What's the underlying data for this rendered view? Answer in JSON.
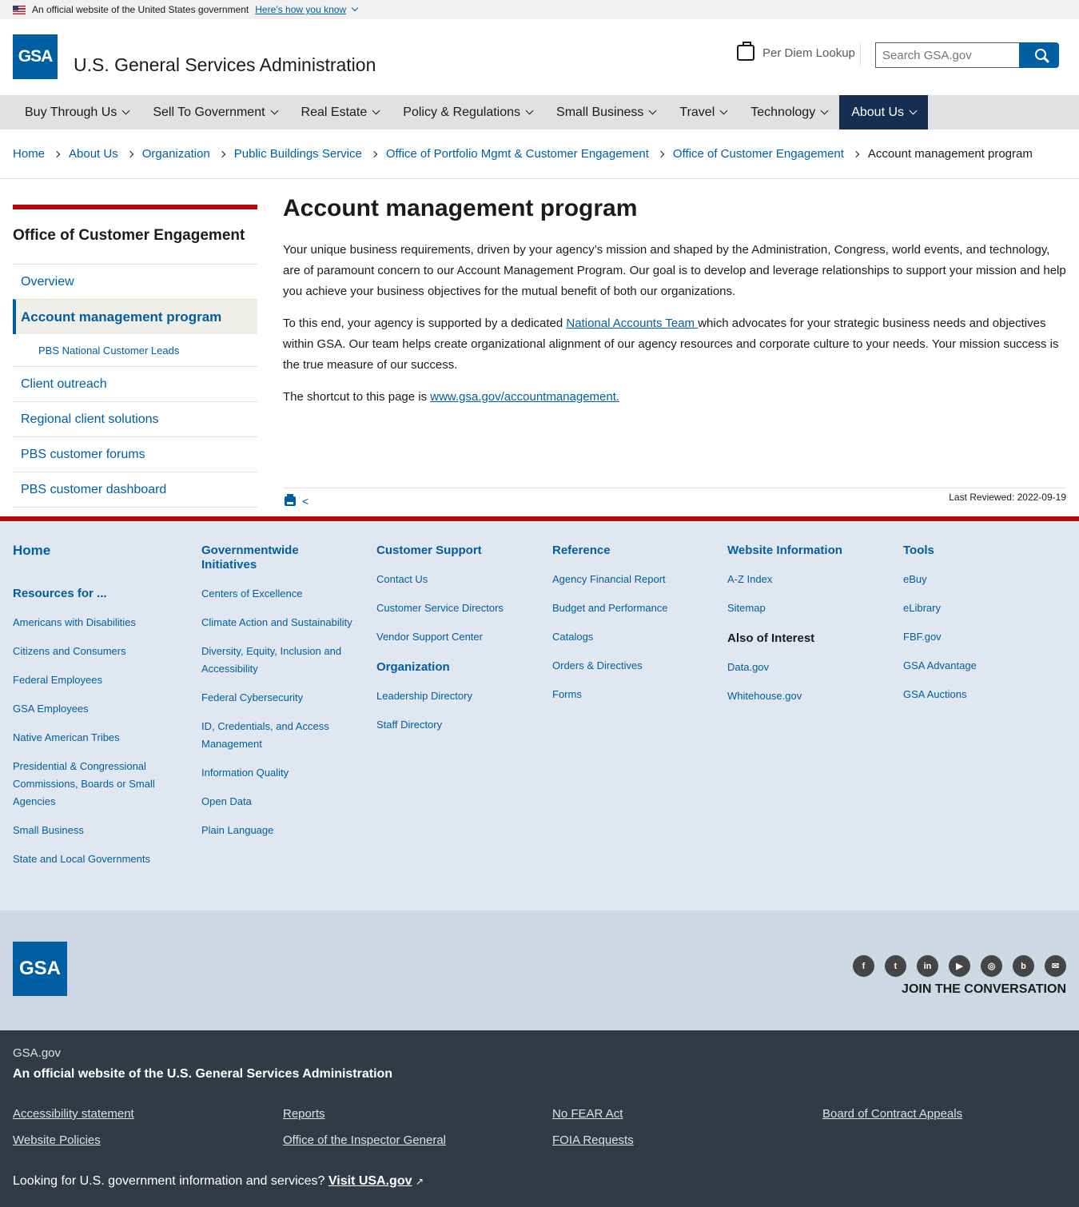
{
  "banner": {
    "text": "An official website of the United States government",
    "link": "Here’s how you know"
  },
  "header": {
    "logo": "GSA",
    "title": "U.S. General Services Administration",
    "perdiem": "Per Diem Lookup",
    "search_placeholder": "Search GSA.gov"
  },
  "nav": [
    "Buy Through Us",
    "Sell To Government",
    "Real Estate",
    "Policy & Regulations",
    "Small Business",
    "Travel",
    "Technology",
    "About Us"
  ],
  "breadcrumbs": [
    "Home",
    "About Us",
    "Organization",
    "Public Buildings Service",
    "Office of Portfolio Mgmt & Customer Engagement",
    "Office of Customer Engagement"
  ],
  "breadcrumb_current": "Account management program",
  "side": {
    "title": "Office of Customer Engagement",
    "items": [
      "Overview",
      "Account management program",
      "PBS National Customer Leads",
      "Client outreach",
      "Regional client solutions",
      "PBS customer forums",
      "PBS customer dashboard"
    ]
  },
  "main": {
    "title": "Account management program",
    "p1": "Your unique business requirements, driven by your agency’s mission and shaped by the Administration, Congress, world events, and technology, are of paramount concern to our Account Management Program. Our goal is to develop and leverage relationships to support your mission and help you achieve your business objectives for the mutual benefit of both our organizations.",
    "p2_pre": "To this end, your agency is supported by a dedicated ",
    "p2_link": "National Accounts Team ",
    "p2_post": "which advocates for your strategic business needs and objectives within GSA.  Our team helps create organizational alignment of our agency resources and corporate culture to your needs.  Your mission success is the true measure of our success.",
    "p3_pre": "The shortcut to this page is ",
    "p3_link": "www.gsa.gov/accountmanagement.",
    "reviewed": "Last Reviewed: 2022-09-19"
  },
  "footer": {
    "home": "Home",
    "resources_title": "Resources for ...",
    "resources": [
      "Americans with Disabilities",
      "Citizens and Consumers",
      "Federal Employees",
      "GSA Employees",
      "Native American Tribes",
      "Presidential & Congressional Commissions, Boards or Small Agencies",
      "Small Business",
      "State and Local Governments"
    ],
    "gov_title": "Governmentwide Initiatives",
    "gov": [
      "Centers of Excellence",
      "Climate Action and Sustainability",
      "Diversity, Equity, Inclusion and Accessibility",
      "Federal Cybersecurity",
      "ID, Credentials, and Access Management",
      "Information Quality",
      "Open Data",
      "Plain Language"
    ],
    "support_title": "Customer Support",
    "support": [
      "Contact Us",
      "Customer Service Directors",
      "Vendor Support Center"
    ],
    "org_title": "Organization",
    "org": [
      "Leadership Directory",
      "Staff Directory"
    ],
    "ref_title": "Reference",
    "ref": [
      "Agency Financial Report",
      "Budget and Performance",
      "Catalogs",
      "Orders & Directives",
      "Forms"
    ],
    "web_title": "Website Information",
    "web": [
      "A-Z Index",
      "Sitemap"
    ],
    "interest_title": "Also of Interest",
    "interest": [
      "Data.gov",
      "Whitehouse.gov"
    ],
    "tools_title": "Tools",
    "tools": [
      "eBuy",
      "eLibrary",
      "FBF.gov",
      "GSA Advantage",
      "GSA Auctions"
    ],
    "join": "JOIN THE CONVERSATION",
    "site": "GSA.gov",
    "official": "An official website of the U.S. General Services Administration",
    "links": [
      "Accessibility statement",
      "Reports",
      "No FEAR Act",
      "Board of Contract Appeals",
      "Website Policies",
      "Office of the Inspector General",
      "FOIA Requests"
    ],
    "usa_pre": "Looking for U.S. government information and services? ",
    "usa_link": "Visit USA.gov"
  },
  "social": [
    {
      "icon": "facebook-icon",
      "glyph": "f"
    },
    {
      "icon": "twitter-icon",
      "glyph": "t"
    },
    {
      "icon": "linkedin-icon",
      "glyph": "in"
    },
    {
      "icon": "youtube-icon",
      "glyph": "▶"
    },
    {
      "icon": "instagram-icon",
      "glyph": "◎"
    },
    {
      "icon": "blog-icon",
      "glyph": "b"
    },
    {
      "icon": "email-icon",
      "glyph": "✉"
    }
  ]
}
